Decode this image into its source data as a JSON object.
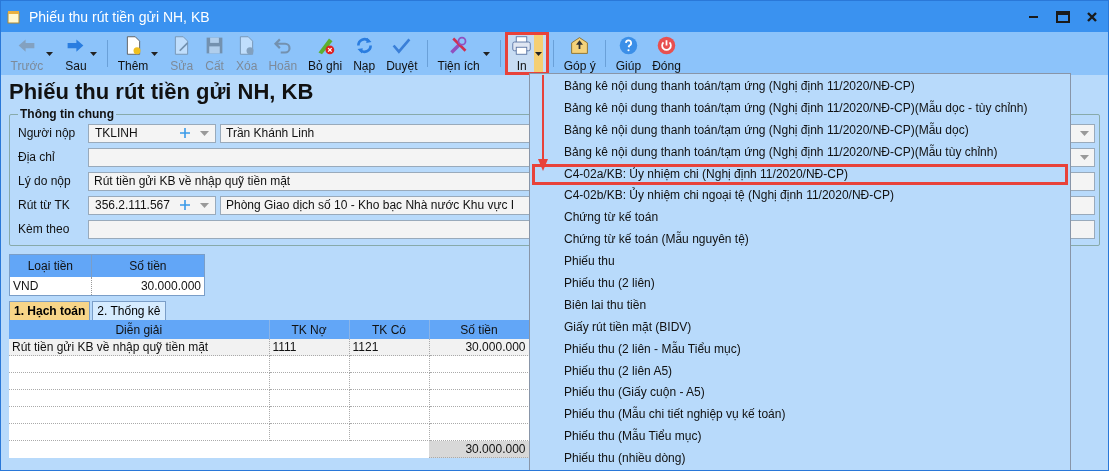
{
  "window": {
    "title": "Phiếu thu rút tiền gửi NH, KB"
  },
  "toolbar": [
    {
      "items": [
        {
          "label": "Trước",
          "disabled": true,
          "has_menu": true,
          "active": false
        },
        {
          "label": "Sau",
          "disabled": false,
          "has_menu": true,
          "active": false
        }
      ]
    },
    {
      "items": [
        {
          "label": "Thêm",
          "disabled": false,
          "has_menu": true,
          "active": false
        },
        {
          "label": "Sửa",
          "disabled": true,
          "has_menu": false,
          "active": false
        },
        {
          "label": "Cất",
          "disabled": true,
          "has_menu": false,
          "active": false
        },
        {
          "label": "Xóa",
          "disabled": true,
          "has_menu": false,
          "active": false
        },
        {
          "label": "Hoãn",
          "disabled": true,
          "has_menu": false,
          "active": false
        },
        {
          "label": "Bỏ ghi",
          "disabled": false,
          "has_menu": false,
          "active": false
        },
        {
          "label": "Nạp",
          "disabled": false,
          "has_menu": false,
          "active": false
        },
        {
          "label": "Duyệt",
          "disabled": false,
          "has_menu": false,
          "active": false
        }
      ]
    },
    {
      "items": [
        {
          "label": "Tiện ích",
          "disabled": false,
          "has_menu": true,
          "active": false
        }
      ]
    },
    {
      "items": [
        {
          "label": "In",
          "disabled": false,
          "has_menu": true,
          "active": true
        }
      ]
    },
    {
      "items": [
        {
          "label": "Góp ý",
          "disabled": false,
          "has_menu": false,
          "active": false
        }
      ]
    },
    {
      "items": [
        {
          "label": "Giúp",
          "disabled": false,
          "has_menu": false,
          "active": false
        },
        {
          "label": "Đóng",
          "disabled": false,
          "has_menu": false,
          "active": false
        }
      ]
    }
  ],
  "page_title": "Phiếu thu rút tiền gửi NH, KB",
  "general_info": {
    "title": "Thông tin chung",
    "fields": [
      {
        "label": "Người nộp",
        "kind": "lookup",
        "code": "TKLINH",
        "value": "Trần Khánh Linh",
        "dropdown": true
      },
      {
        "label": "Địa chỉ",
        "kind": "text",
        "dropdown": true
      },
      {
        "label": "Lý do nộp",
        "kind": "text",
        "value": "Rút tiền gửi KB về nhập quỹ tiền mặt",
        "dropdown": false
      },
      {
        "label": "Rút từ TK",
        "kind": "lookup",
        "code": "356.2.111.567",
        "value": "Phòng Giao dịch số 10 - Kho bạc Nhà nước Khu vực I",
        "dropdown": false
      },
      {
        "label": "Kèm theo",
        "kind": "text",
        "dropdown": false
      }
    ]
  },
  "currency_table": {
    "columns": [
      "Loại tiền",
      "Số tiền"
    ],
    "rows": [
      [
        "VND",
        "30.000.000"
      ]
    ]
  },
  "tabs": [
    {
      "label": "1. Hạch toán",
      "selected": true
    },
    {
      "label": "2. Thống kê",
      "selected": false
    }
  ],
  "entries_table": {
    "columns": [
      "Diễn giải",
      "TK Nợ",
      "TK Có",
      "Số tiền"
    ],
    "rows": [
      [
        "Rút tiền gửi KB về nhập quỹ tiền mặt",
        "1111",
        "1121",
        "30.000.000"
      ]
    ],
    "total": "30.000.000"
  },
  "print_menu": [
    {
      "label": "Bảng kê nội dung thanh toán/tạm ứng (Nghị định 11/2020/NĐ-CP)",
      "selected": false
    },
    {
      "label": "Bảng kê nội dung thanh toán/tạm ứng (Nghị định 11/2020/NĐ-CP)(Mẫu dọc - tùy chỉnh)",
      "selected": false
    },
    {
      "label": "Bảng kê nội dung thanh toán/tạm ứng (Nghị định 11/2020/NĐ-CP)(Mẫu dọc)",
      "selected": false
    },
    {
      "label": "Bảng kê nội dung thanh toán/tạm ứng (Nghị định 11/2020/NĐ-CP)(Mẫu tùy chỉnh)",
      "selected": false
    },
    {
      "label": "C4-02a/KB: Ủy nhiệm chi (Nghị định 11/2020/NĐ-CP)",
      "selected": true
    },
    {
      "label": "C4-02b/KB: Ủy nhiệm chi ngoại tệ (Nghị định 11/2020/NĐ-CP)",
      "selected": false
    },
    {
      "label": "Chứng từ kế toán",
      "selected": false
    },
    {
      "label": "Chứng từ kế toán (Mẫu nguyên tệ)",
      "selected": false
    },
    {
      "label": "Phiếu thu",
      "selected": false
    },
    {
      "label": "Phiếu thu (2 liên)",
      "selected": false
    },
    {
      "label": "Biên lai thu tiền",
      "selected": false
    },
    {
      "label": "Giấy rút tiền mặt (BIDV)",
      "selected": false
    },
    {
      "label": "Phiếu thu (2 liên - Mẫu Tiểu mục)",
      "selected": false
    },
    {
      "label": "Phiếu thu (2 liên A5)",
      "selected": false
    },
    {
      "label": "Phiếu thu (Giấy cuộn - A5)",
      "selected": false
    },
    {
      "label": "Phiếu thu (Mẫu chi tiết nghiệp vụ kế toán)",
      "selected": false
    },
    {
      "label": "Phiếu thu (Mẫu Tiểu mục)",
      "selected": false
    },
    {
      "label": "Phiếu thu (nhiều dòng)",
      "selected": false
    }
  ]
}
